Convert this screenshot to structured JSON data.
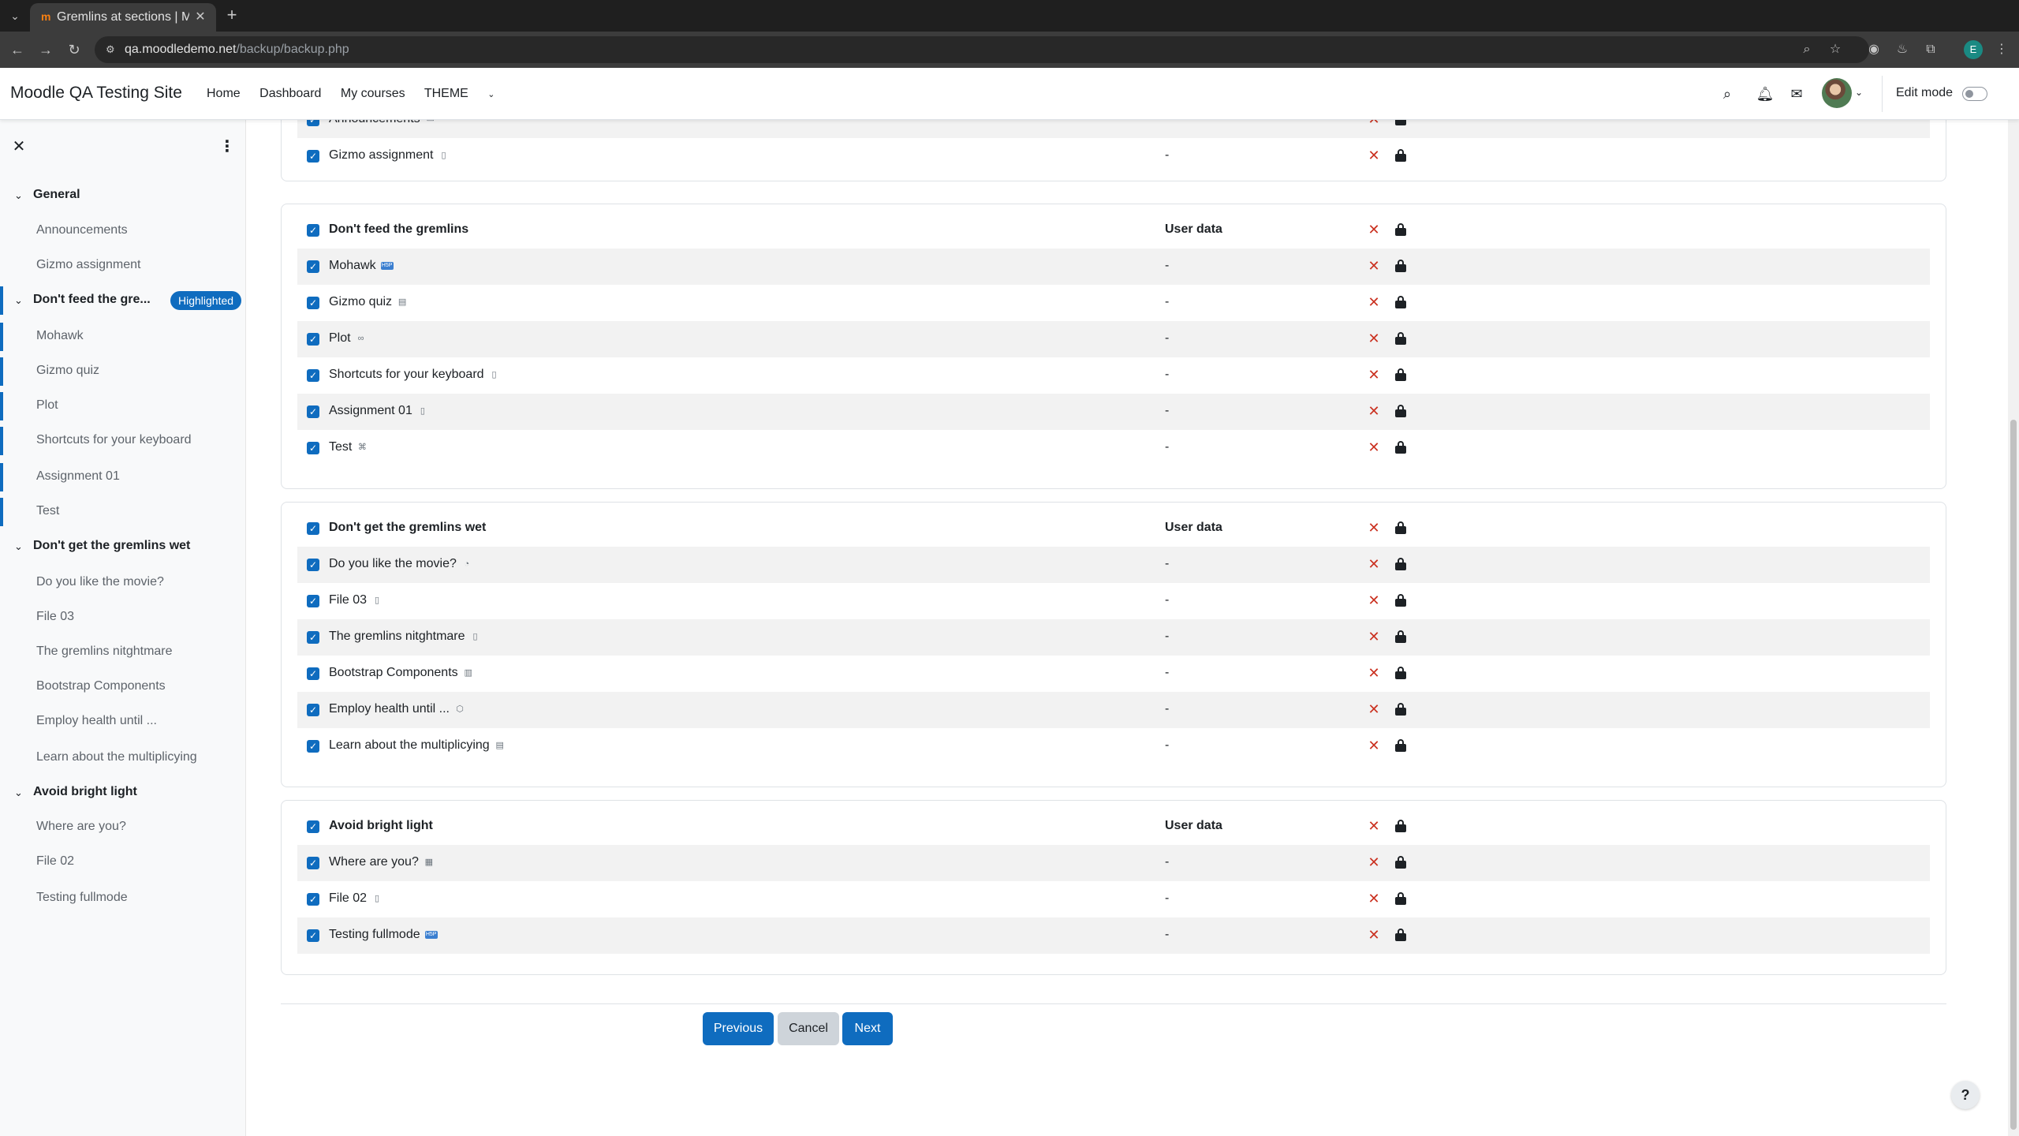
{
  "browser": {
    "tab_title": "Gremlins at sections | Mo",
    "tab_favicon": "m",
    "url_host": "qa.moodledemo.net",
    "url_path": "/backup/backup.php",
    "profile_initial": "E"
  },
  "navbar": {
    "site_name": "Moodle QA Testing Site",
    "links": [
      "Home",
      "Dashboard",
      "My courses",
      "THEME"
    ],
    "edit_mode_label": "Edit mode"
  },
  "drawer": {
    "highlight_badge": "Highlighted",
    "items": [
      {
        "type": "section",
        "label": "General"
      },
      {
        "type": "activity",
        "label": "Announcements"
      },
      {
        "type": "activity",
        "label": "Gizmo assignment"
      },
      {
        "type": "section",
        "label": "Don't feed the gre...",
        "highlighted": true
      },
      {
        "type": "activity",
        "label": "Mohawk",
        "highlighted": true
      },
      {
        "type": "activity",
        "label": "Gizmo quiz",
        "highlighted": true
      },
      {
        "type": "activity",
        "label": "Plot",
        "highlighted": true
      },
      {
        "type": "activity",
        "label": "Shortcuts for your keyboard",
        "highlighted": true
      },
      {
        "type": "activity",
        "label": "Assignment 01",
        "highlighted": true
      },
      {
        "type": "activity",
        "label": "Test",
        "highlighted": true
      },
      {
        "type": "section",
        "label": "Don't get the gremlins wet"
      },
      {
        "type": "activity",
        "label": "Do you like the movie?"
      },
      {
        "type": "activity",
        "label": "File 03"
      },
      {
        "type": "activity",
        "label": "The gremlins nitghtmare"
      },
      {
        "type": "activity",
        "label": "Bootstrap Components"
      },
      {
        "type": "activity",
        "label": "Employ health until ..."
      },
      {
        "type": "activity",
        "label": "Learn about the multiplicying"
      },
      {
        "type": "section",
        "label": "Avoid bright light"
      },
      {
        "type": "activity",
        "label": "Where are you?"
      },
      {
        "type": "activity",
        "label": "File 02"
      },
      {
        "type": "activity",
        "label": "Testing fullmode"
      }
    ]
  },
  "sections": [
    {
      "rows": [
        {
          "label": "Announcements",
          "icon": "forum-icon",
          "glyph": "▭",
          "data": "-",
          "head": false
        },
        {
          "label": "Gizmo assignment",
          "icon": "assignment-icon",
          "glyph": "▯",
          "data": "-",
          "head": false
        }
      ]
    },
    {
      "rows": [
        {
          "label": "Don't feed the gremlins",
          "data": "User data",
          "head": true
        },
        {
          "label": "Mohawk",
          "icon": "h5p-icon",
          "glyph": "H5P",
          "data": "-",
          "head": false
        },
        {
          "label": "Gizmo quiz",
          "icon": "quiz-icon",
          "glyph": "▤",
          "data": "-",
          "head": false
        },
        {
          "label": "Plot",
          "icon": "url-link-icon",
          "glyph": "∞",
          "data": "-",
          "head": false
        },
        {
          "label": "Shortcuts for your keyboard",
          "icon": "page-icon",
          "glyph": "▯",
          "data": "-",
          "head": false
        },
        {
          "label": "Assignment 01",
          "icon": "assignment-icon",
          "glyph": "▯",
          "data": "-",
          "head": false
        },
        {
          "label": "Test",
          "icon": "lesson-icon",
          "glyph": "⌘",
          "data": "-",
          "head": false
        }
      ]
    },
    {
      "rows": [
        {
          "label": "Don't get the gremlins wet",
          "data": "User data",
          "head": true
        },
        {
          "label": "Do you like the movie?",
          "icon": "feedback-icon",
          "glyph": "◔",
          "data": "-",
          "head": false
        },
        {
          "label": "File 03",
          "icon": "file-icon",
          "glyph": "▯",
          "data": "-",
          "head": false
        },
        {
          "label": "The gremlins nitghtmare",
          "icon": "page-icon",
          "glyph": "▯",
          "data": "-",
          "head": false
        },
        {
          "label": "Bootstrap Components",
          "icon": "book-icon",
          "glyph": "▥",
          "data": "-",
          "head": false
        },
        {
          "label": "Employ health until ...",
          "icon": "scorm-icon",
          "glyph": "⬡",
          "data": "-",
          "head": false
        },
        {
          "label": "Learn about the multiplicying",
          "icon": "glossary-icon",
          "glyph": "▤",
          "data": "-",
          "head": false
        }
      ]
    },
    {
      "rows": [
        {
          "label": "Avoid bright light",
          "data": "User data",
          "head": true
        },
        {
          "label": "Where are you?",
          "icon": "choice-icon",
          "glyph": "▦",
          "data": "-",
          "head": false
        },
        {
          "label": "File 02",
          "icon": "file-icon",
          "glyph": "▯",
          "data": "-",
          "head": false
        },
        {
          "label": "Testing fullmode",
          "icon": "h5p-icon",
          "glyph": "H5P",
          "data": "-",
          "head": false
        }
      ]
    }
  ],
  "buttons": {
    "previous": "Previous",
    "cancel": "Cancel",
    "next": "Next"
  },
  "help": "?"
}
